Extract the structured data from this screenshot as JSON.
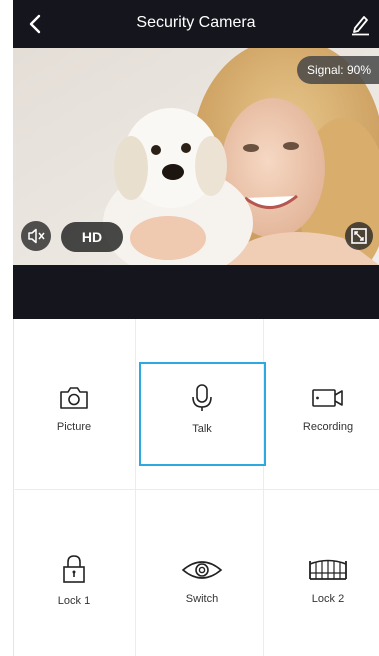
{
  "header": {
    "title": "Security Camera",
    "back_icon": "chevron-left-icon",
    "edit_icon": "pencil-icon"
  },
  "video": {
    "signal_label": "Signal: 90%",
    "hd_label": "HD",
    "mute_icon": "speaker-muted-icon",
    "fullscreen_icon": "fullscreen-icon"
  },
  "controls": [
    {
      "label": "Picture",
      "icon": "camera-icon"
    },
    {
      "label": "Talk",
      "icon": "microphone-icon",
      "selected": true
    },
    {
      "label": "Recording",
      "icon": "video-camera-icon"
    },
    {
      "label": "Lock 1",
      "icon": "lock-icon"
    },
    {
      "label": "Switch",
      "icon": "eye-icon"
    },
    {
      "label": "Lock 2",
      "icon": "gate-icon"
    }
  ],
  "colors": {
    "header_bg": "#15151d",
    "selected_border": "#2ea9df"
  }
}
